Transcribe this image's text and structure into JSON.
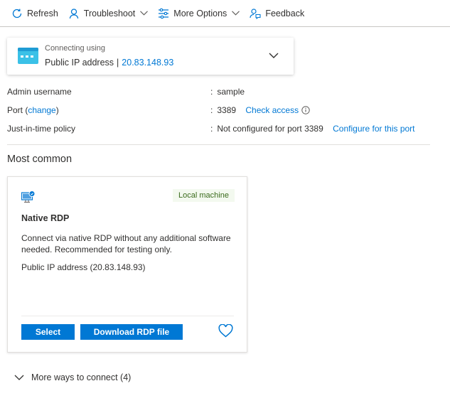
{
  "toolbar": {
    "refresh": "Refresh",
    "troubleshoot": "Troubleshoot",
    "more_options": "More Options",
    "feedback": "Feedback"
  },
  "connection": {
    "label": "Connecting using",
    "type": "Public IP address",
    "separator": "|",
    "ip": "20.83.148.93"
  },
  "properties": {
    "admin": {
      "key": "Admin username",
      "value": "sample"
    },
    "port": {
      "key_prefix": "Port (",
      "key_link": "change",
      "key_suffix": ")",
      "value": "3389",
      "action": "Check access"
    },
    "jit": {
      "key": "Just-in-time policy",
      "value": "Not configured for port 3389",
      "action": "Configure for this port"
    },
    "colon": ":"
  },
  "section": {
    "title": "Most common"
  },
  "rdp_card": {
    "badge": "Local machine",
    "title": "Native RDP",
    "description": "Connect via native RDP without any additional software needed. Recommended for testing only.",
    "ip_text": "Public IP address (20.83.148.93)",
    "select_label": "Select",
    "download_label": "Download RDP file"
  },
  "more_ways": {
    "label": "More ways to connect (4)"
  },
  "colors": {
    "accent": "#0078d4",
    "badge_bg": "#f3f9ef",
    "badge_text": "#3a6b1c"
  }
}
